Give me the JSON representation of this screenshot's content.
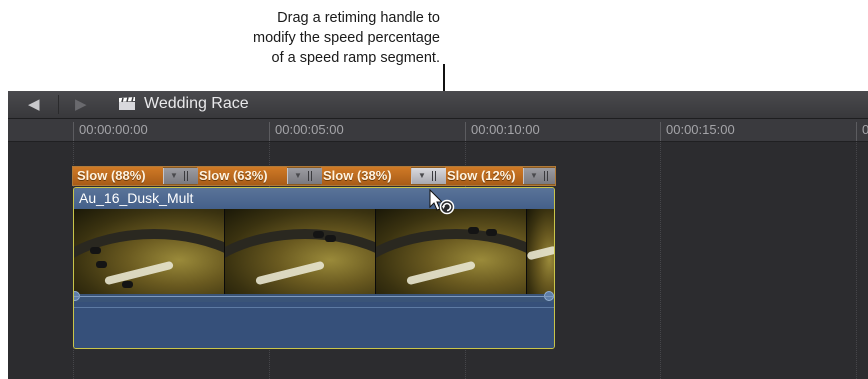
{
  "callout": {
    "lines": [
      "Drag a retiming handle to",
      "modify the speed percentage",
      "of a speed ramp segment."
    ]
  },
  "toolbar": {
    "back_icon": "back-arrow-icon",
    "forward_icon": "forward-arrow-icon",
    "project_icon": "clapperboard-icon",
    "project_title": "Wedding Race"
  },
  "ruler": {
    "timecodes": [
      "00:00:00:00",
      "00:00:05:00",
      "00:00:10:00",
      "00:00:15:00",
      "0"
    ]
  },
  "retime": {
    "segments": [
      "Slow (88%)",
      "Slow (63%)",
      "Slow (38%)",
      "Slow (12%)"
    ]
  },
  "clip": {
    "name": "Au_16_Dusk_Mult"
  },
  "colors": {
    "retime_segment": "#c26d1f",
    "clip_body": "#3a5478",
    "clip_border": "#c9c54a",
    "timeline_bg": "#2c2c2f"
  }
}
